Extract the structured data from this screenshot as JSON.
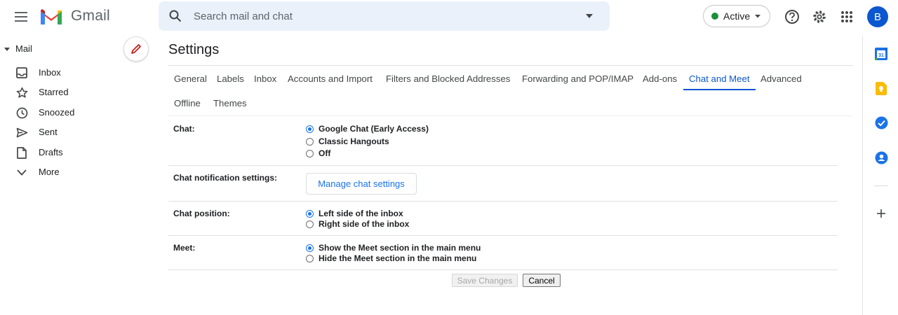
{
  "app": {
    "name": "Gmail"
  },
  "search": {
    "placeholder": "Search mail and chat"
  },
  "status": {
    "label": "Active",
    "color": "#1e8e3e"
  },
  "account": {
    "initial": "B",
    "color": "#0b57d0"
  },
  "nav": {
    "section_label": "Mail",
    "items": [
      {
        "label": "Inbox",
        "icon": "inbox-icon"
      },
      {
        "label": "Starred",
        "icon": "star-icon"
      },
      {
        "label": "Snoozed",
        "icon": "clock-icon"
      },
      {
        "label": "Sent",
        "icon": "send-icon"
      },
      {
        "label": "Drafts",
        "icon": "draft-icon"
      },
      {
        "label": "More",
        "icon": "chevron-down-icon"
      }
    ]
  },
  "settings": {
    "title": "Settings",
    "tabs": [
      "General",
      "Labels",
      "Inbox",
      "Accounts and Import",
      "Filters and Blocked Addresses",
      "Forwarding and POP/IMAP",
      "Add-ons",
      "Chat and Meet",
      "Advanced",
      "Offline",
      "Themes"
    ],
    "active_tab": "Chat and Meet",
    "rows": {
      "chat": {
        "label": "Chat:",
        "options": [
          "Google Chat (Early Access)",
          "Classic Hangouts",
          "Off"
        ],
        "selected": "Google Chat (Early Access)"
      },
      "notifications": {
        "label": "Chat notification settings:",
        "button": "Manage chat settings"
      },
      "position": {
        "label": "Chat position:",
        "options": [
          "Left side of the inbox",
          "Right side of the inbox"
        ],
        "selected": "Left side of the inbox"
      },
      "meet": {
        "label": "Meet:",
        "options": [
          "Show the Meet section in the main menu",
          "Hide the Meet section in the main menu"
        ],
        "selected": "Show the Meet section in the main menu"
      }
    },
    "buttons": {
      "save": "Save Changes",
      "cancel": "Cancel"
    }
  },
  "side_panel": {
    "icons": [
      "calendar-icon",
      "keep-icon",
      "tasks-icon",
      "contacts-icon",
      "plus-icon"
    ],
    "calendar_day": "31"
  },
  "colors": {
    "accent": "#0b57d0",
    "search_bg": "#eaf1fb"
  }
}
